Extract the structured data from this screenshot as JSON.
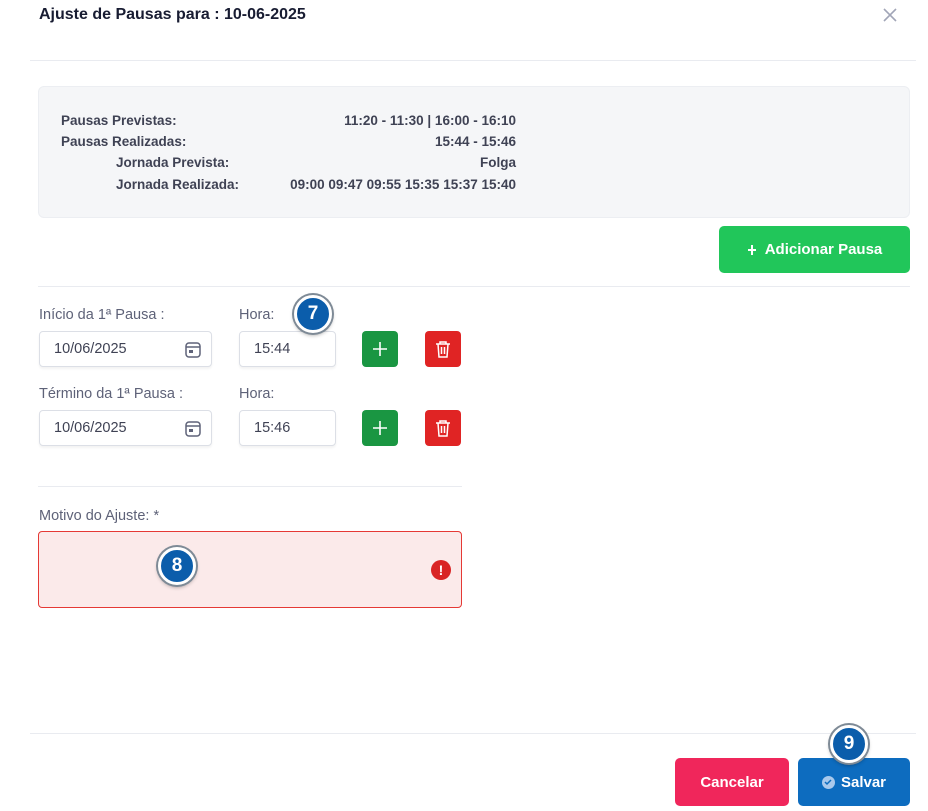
{
  "dialog": {
    "title": "Ajuste de Pausas para : 10-06-2025"
  },
  "summary": {
    "pausas_previstas_label": "Pausas Previstas:",
    "pausas_previstas_value": "11:20 - 11:30 | 16:00 - 16:10",
    "pausas_realizadas_label": "Pausas Realizadas:",
    "pausas_realizadas_value": "15:44 - 15:46",
    "jornada_prevista_label": "Jornada Prevista:",
    "jornada_prevista_value": "Folga",
    "jornada_realizada_label": "Jornada Realizada:",
    "jornada_realizada_value": "09:00 09:47 09:55 15:35 15:37 15:40"
  },
  "add_pause_button": {
    "icon": "plus-icon",
    "label": "Adicionar Pausa"
  },
  "pause": {
    "start": {
      "date_label": "Início da 1ª Pausa :",
      "date_value": "10/06/2025",
      "time_label": "Hora:",
      "time_value": "15:44"
    },
    "end": {
      "date_label": "Término da 1ª Pausa :",
      "date_value": "10/06/2025",
      "time_label": "Hora:",
      "time_value": "15:46"
    }
  },
  "reason": {
    "label": "Motivo do Ajuste: *",
    "value": ""
  },
  "badges": [
    "7",
    "8",
    "9"
  ],
  "footer": {
    "cancel_label": "Cancelar",
    "save_label": "Salvar"
  },
  "colors": {
    "add_button": "#21c65a",
    "row_add": "#1a9642",
    "row_delete": "#e02424",
    "cancel": "#f0265b",
    "save": "#0d6cbf",
    "error": "#e53935",
    "badge": "#0b5dab"
  }
}
